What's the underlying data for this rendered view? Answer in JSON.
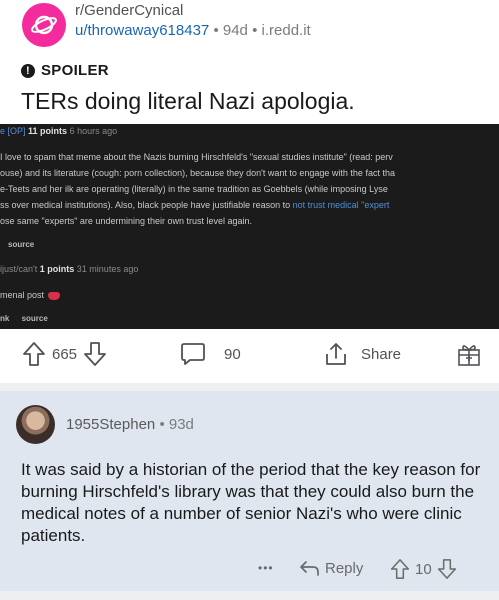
{
  "post": {
    "subreddit": "r/GenderCynical",
    "author": "u/throwaway618437",
    "age": "94d",
    "domain": "i.redd.it",
    "sep": "•",
    "flair": "SPOILER",
    "title": "TERs doing literal Nazi apologia."
  },
  "embed": {
    "line_op_prefix": "e [OP]",
    "line_op_points": "11 points",
    "line_op_time": "6 hours ago",
    "body1": "I love to spam that meme about the Nazis burning Hirschfeld's \"sexual studies institute\" (read: perv",
    "body2": "ouse) and its literature (cough: porn collection), because they don't want to engage with the fact tha",
    "body3": "e-Teets and her ilk are operating (literally) in the same tradition as Goebbels (while imposing Lyse",
    "body4_a": "ss over medical institutions). Also, black people have justifiable reason to ",
    "body4_link": "not trust medical \"expert",
    "body5": "ose same \"experts\" are undermining their own trust level again.",
    "source1": "source",
    "reply_user": "ijust/can't",
    "reply_points": "1 points",
    "reply_time": "31 minutes ago",
    "reply_text": "menal post",
    "reply_link": "nk",
    "source2": "source"
  },
  "actions": {
    "upvotes": "665",
    "comments": "90",
    "share": "Share"
  },
  "comment": {
    "author": "1955Stephen",
    "sep": "•",
    "age": "93d",
    "body": "It was said by a historian of the period that the key reason for burning Hirschfeld's library was that they could also burn the medical notes of a number of senior Nazi's who were clinic patients.",
    "more": "•••",
    "reply": "Reply",
    "votes": "10"
  },
  "colors": {
    "subreddit_icon": "#f42b9c",
    "link_blue": "#1a66b3",
    "comment_bg": "#dfe6f0",
    "embed_bg": "#1b1b1c"
  },
  "icons": [
    "planet-icon",
    "alert-icon",
    "upvote-icon",
    "downvote-icon",
    "comment-icon",
    "share-icon",
    "award-icon",
    "more-icon",
    "reply-icon"
  ]
}
